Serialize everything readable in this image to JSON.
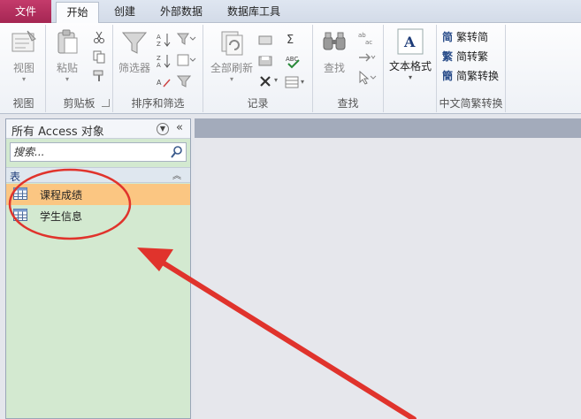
{
  "tabs": [
    {
      "label": "文件"
    },
    {
      "label": "开始"
    },
    {
      "label": "创建"
    },
    {
      "label": "外部数据"
    },
    {
      "label": "数据库工具"
    }
  ],
  "active_tab": "开始",
  "ribbon": {
    "groups": {
      "view": {
        "label": "视图",
        "button": "视图"
      },
      "clipboard": {
        "label": "剪贴板",
        "button": "粘贴"
      },
      "sort_filter": {
        "label": "排序和筛选",
        "button": "筛选器"
      },
      "records": {
        "label": "记录",
        "button": "全部刷新"
      },
      "find": {
        "label": "查找",
        "button": "查找"
      },
      "text_format": {
        "button": "文本格式"
      },
      "chinese_conversion": {
        "label": "中文简繁转换",
        "items": [
          "繁转简",
          "简转繁",
          "简繁转换"
        ],
        "glyphs": [
          "简",
          "繁",
          "簡"
        ]
      }
    }
  },
  "nav_pane": {
    "title": "所有 Access 对象",
    "search_placeholder": "搜索...",
    "section_label": "表",
    "items": [
      {
        "label": "课程成绩",
        "selected": true
      },
      {
        "label": "学生信息",
        "selected": false
      }
    ]
  },
  "colors": {
    "file_tab": "#b3305f",
    "nav_background": "#d3e9d0",
    "selected_item": "#fbc682",
    "annotation": "#e0332c"
  }
}
